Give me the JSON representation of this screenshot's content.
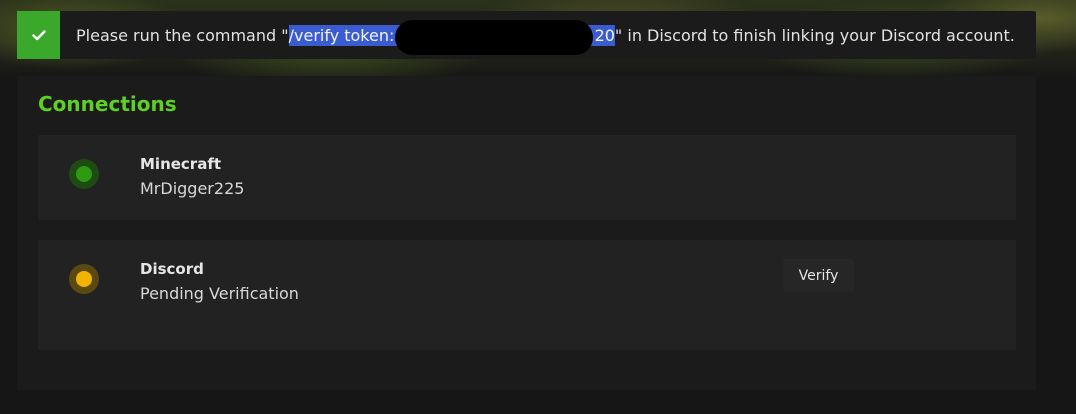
{
  "notice": {
    "text_before": "Please run the command \"",
    "command_visible_start": "/verify token:6",
    "command_visible_end": "20",
    "text_after": "\" in Discord to finish linking your Discord account.",
    "icon": "checkmark-icon"
  },
  "connections": {
    "title": "Connections",
    "items": [
      {
        "name": "Minecraft",
        "value": "MrDigger225",
        "status": "linked",
        "dot_color": "#2e9a12",
        "dot_ring": "#1f4a14"
      },
      {
        "name": "Discord",
        "value": "Pending Verification",
        "status": "pending",
        "dot_color": "#f1b500",
        "dot_ring": "#5a4a12",
        "action_label": "Verify"
      }
    ]
  },
  "colors": {
    "accent_green": "#5fcf24",
    "success_green": "#3aa82b",
    "selection_blue": "#3b5bd0"
  }
}
